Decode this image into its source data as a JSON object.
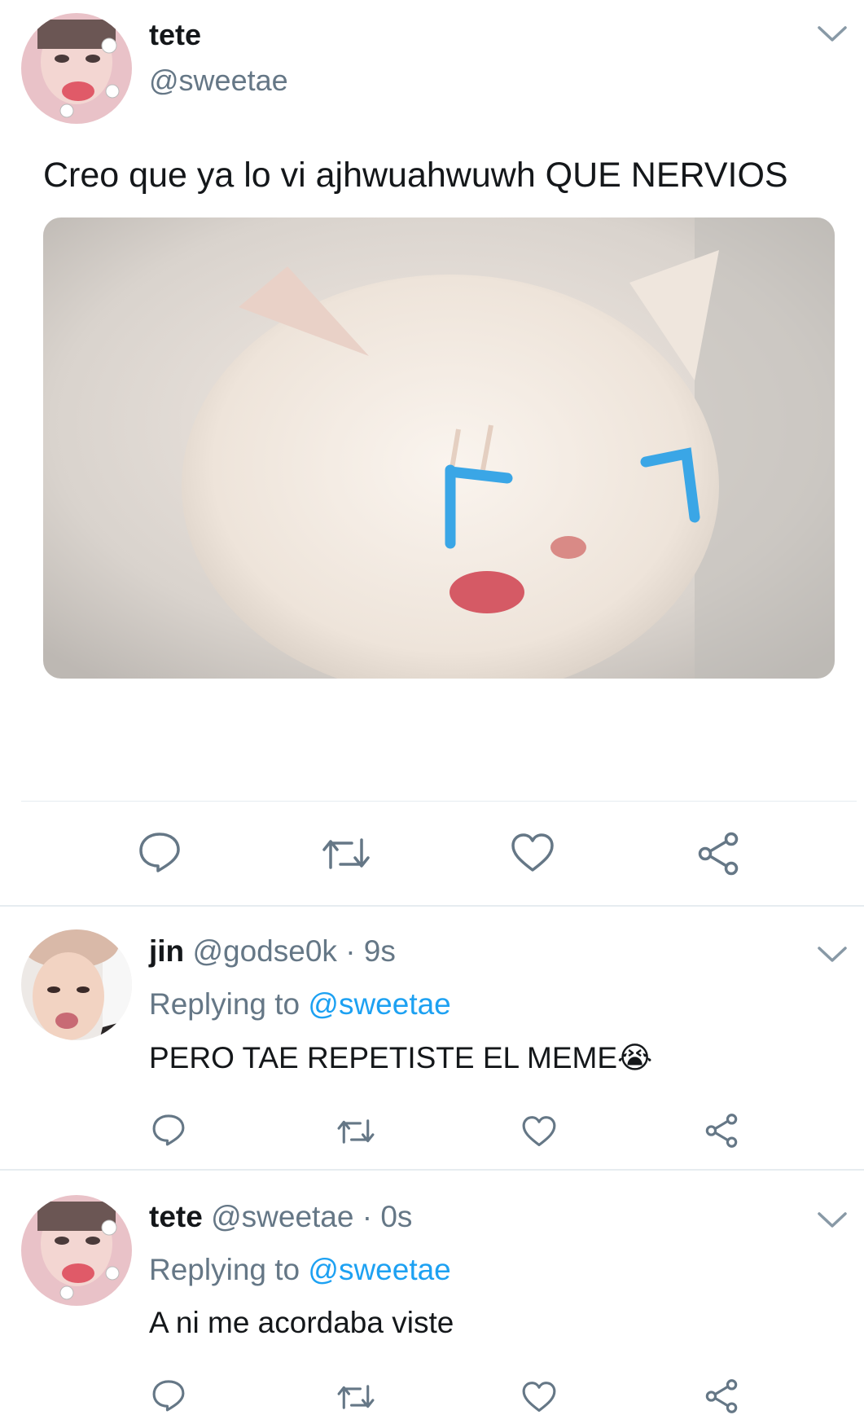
{
  "main_tweet": {
    "name": "tete",
    "handle": "@sweetae",
    "text": "Creo que ya lo vi ajhwuahwuwh QUE NERVIOS",
    "media_icon": "crying-cat-meme-image",
    "actions": [
      "reply-icon",
      "retweet-icon",
      "like-icon",
      "share-icon"
    ]
  },
  "replies": [
    {
      "name": "jin",
      "handle": "@godse0k",
      "time": "· 9s",
      "replying_prefix": "Replying to",
      "replying_to": "@sweetae",
      "text": "PERO TAE REPETISTE EL MEME😭"
    },
    {
      "name": "tete",
      "handle": "@sweetae",
      "time": "· 0s",
      "replying_prefix": "Replying to",
      "replying_to": "@sweetae",
      "text": "A ni me acordaba viste"
    }
  ],
  "colors": {
    "accent": "#1da1f2",
    "secondary_text": "#657786",
    "icon": "#657786",
    "divider": "#e6ecf0"
  }
}
